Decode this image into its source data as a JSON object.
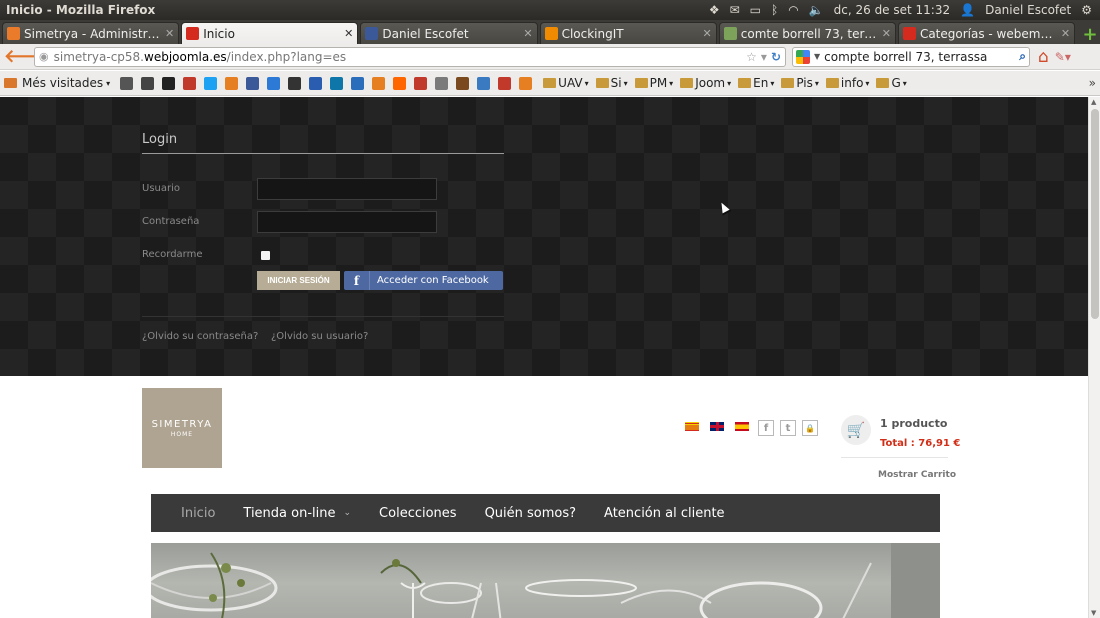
{
  "window": {
    "title": "Inicio - Mozilla Firefox"
  },
  "tray": {
    "datetime": "dc, 26 de set 11:32",
    "user": "Daniel Escofet"
  },
  "tabs": [
    {
      "label": "Simetrya - Administración",
      "favicon": "joomla-icon",
      "color": "#e97b2a",
      "active": false
    },
    {
      "label": "Inicio",
      "favicon": "webempresa-icon",
      "color": "#d52b1e",
      "active": true
    },
    {
      "label": "Daniel Escofet",
      "favicon": "facebook-icon",
      "color": "#3b5998",
      "active": false
    },
    {
      "label": "ClockingIT",
      "favicon": "clock-icon",
      "color": "#f08a00",
      "active": false
    },
    {
      "label": "comte borrell 73, terra...",
      "favicon": "maps-icon",
      "color": "#7da35a",
      "active": false
    },
    {
      "label": "Categorías - webempre...",
      "favicon": "webempresa-icon",
      "color": "#d52b1e",
      "active": false
    }
  ],
  "navbar": {
    "url_prefix": "simetrya-cp58.",
    "url_host": "webjoomla.es",
    "url_suffix": "/index.php?lang=es",
    "search_value": "compte borrell 73, terrassa"
  },
  "bookmarks": {
    "first": "Més visitades",
    "icon_colors": [
      "#555",
      "#444",
      "#222",
      "#c0392b",
      "#1da1f2",
      "#e67e22",
      "#3b5998",
      "#2d7ad6",
      "#333",
      "#2a5db0",
      "#0e76a8",
      "#2a6ebb",
      "#e67e22",
      "#ff6600",
      "#c0392b",
      "#7a7a7a",
      "#7a4a1e",
      "#3a7ac0",
      "#c0392b",
      "#e67e22"
    ],
    "folders": [
      "UAV",
      "Si",
      "PM",
      "Joom",
      "En",
      "Pis",
      "info",
      "G"
    ]
  },
  "login": {
    "title": "Login",
    "username_label": "Usuario",
    "password_label": "Contraseña",
    "remember_label": "Recordarme",
    "submit_label": "INICIAR SESIÓN",
    "facebook_label": "Acceder con Facebook",
    "forgot_password": "¿Olvido su contraseña?",
    "forgot_username": "¿Olvido su usuario?"
  },
  "logo": {
    "main": "SIMETRYA",
    "sub": "HOME"
  },
  "social": {
    "facebook": "f",
    "twitter": "t",
    "lock": "🔒"
  },
  "cart": {
    "count": "1 producto",
    "total": "Total : 76,91 €",
    "show": "Mostrar Carrito"
  },
  "mainnav": [
    {
      "label": "Inicio",
      "current": true,
      "dropdown": false
    },
    {
      "label": "Tienda on-line",
      "current": false,
      "dropdown": true
    },
    {
      "label": "Colecciones",
      "current": false,
      "dropdown": false
    },
    {
      "label": "Quién somos?",
      "current": false,
      "dropdown": false
    },
    {
      "label": "Atención al cliente",
      "current": false,
      "dropdown": false
    }
  ]
}
